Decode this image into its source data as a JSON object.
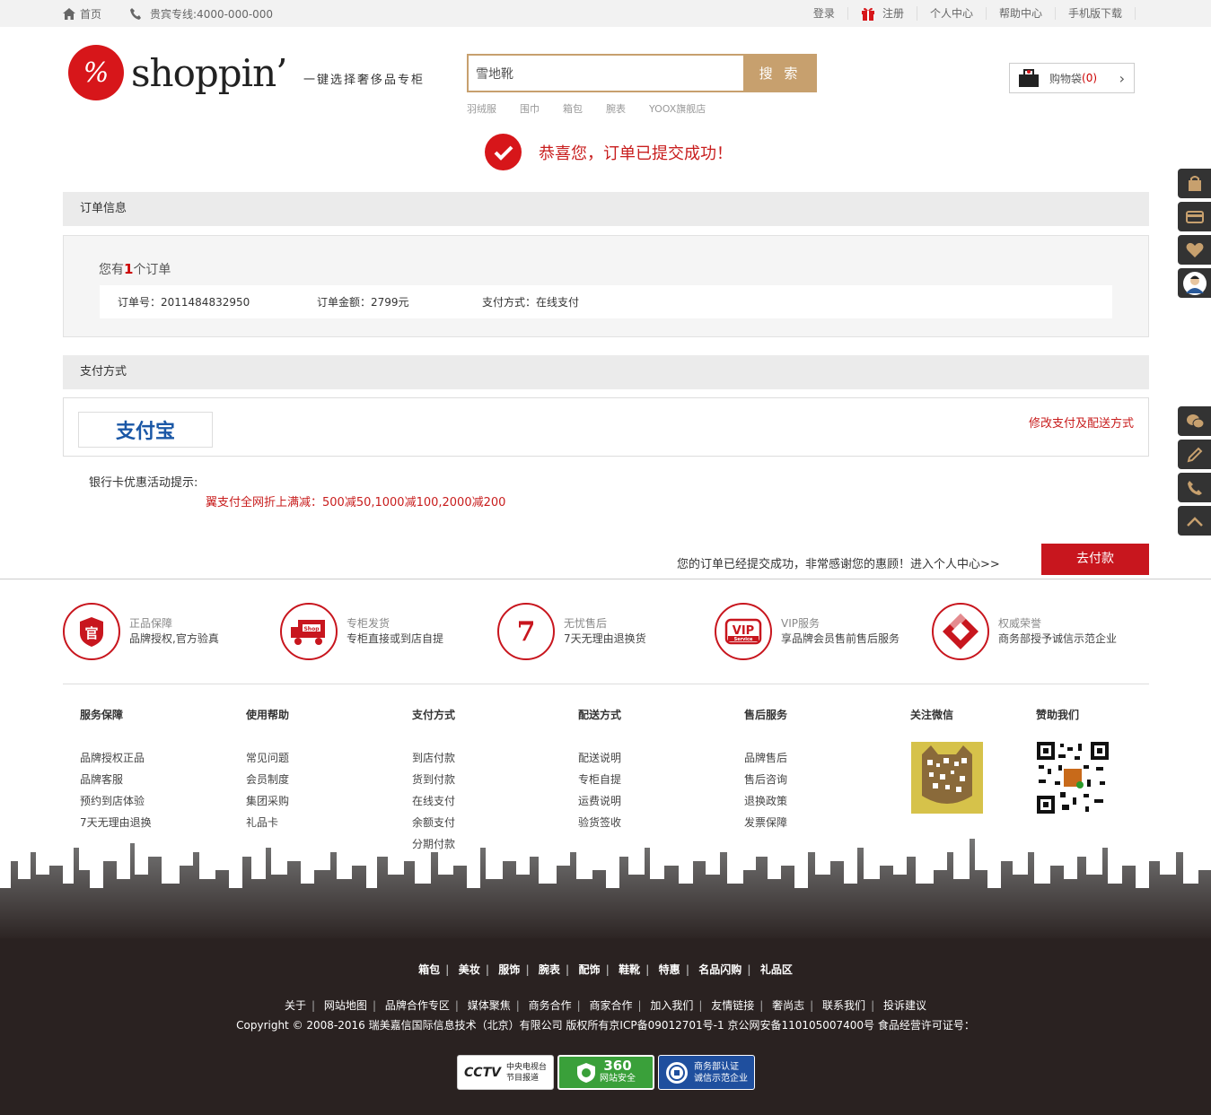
{
  "topbar": {
    "home": "首页",
    "hotline": "贵宾专线:4000-000-000",
    "login": "登录",
    "register": "注册",
    "user_center": "个人中心",
    "help": "帮助中心",
    "mobile": "手机版下载"
  },
  "brand": {
    "logo_mark": "%",
    "name": "shoppin’",
    "slogan": "一键选择奢侈品专柜"
  },
  "search": {
    "value": "雪地靴",
    "button": "搜 索",
    "hot": [
      "羽绒服",
      "围巾",
      "箱包",
      "腕表",
      "YOOX旗舰店"
    ]
  },
  "cart": {
    "label": "购物袋",
    "count_open": "(",
    "count": "0",
    "count_close": ")"
  },
  "success": {
    "message": "恭喜您，订单已提交成功！"
  },
  "order": {
    "section_title": "订单信息",
    "count_prefix": "您有",
    "count": "1",
    "count_suffix": "个订单",
    "number": "订单号：2011484832950",
    "amount": "订单金额：2799元",
    "pay_method": "支付方式：在线支付"
  },
  "payment": {
    "section_title": "支付方式",
    "provider": "支付宝",
    "modify": "修改支付及配送方式",
    "promo_title": "银行卡优惠活动提示:",
    "promo_detail": "翼支付全网折上满减：500减50,1000减100,2000减200"
  },
  "confirm": {
    "text": "您的订单已经提交成功，非常感谢您的惠顾！进入个人中心>>",
    "pay_button": "去付款"
  },
  "features": [
    {
      "icon": "guan",
      "title": "正品保障",
      "desc": "品牌授权,官方验真"
    },
    {
      "icon": "shop",
      "title": "专柜发货",
      "desc": "专柜直接或到店自提"
    },
    {
      "icon": "7",
      "title": "无忧售后",
      "desc": "7天无理由退换货"
    },
    {
      "icon": "VIP",
      "title": "VIP服务",
      "desc": "享品牌会员售前售后服务"
    },
    {
      "icon": "honor",
      "title": "权威荣誉",
      "desc": "商务部授予诚信示范企业"
    }
  ],
  "footer_cols": [
    {
      "title": "服务保障",
      "items": [
        "品牌授权正品",
        "品牌客服",
        "预约到店体验",
        "7天无理由退换"
      ]
    },
    {
      "title": "使用帮助",
      "items": [
        "常见问题",
        "会员制度",
        "集团采购",
        "礼品卡"
      ]
    },
    {
      "title": "支付方式",
      "items": [
        "到店付款",
        "货到付款",
        "在线支付",
        "余额支付",
        "分期付款"
      ]
    },
    {
      "title": "配送方式",
      "items": [
        "配送说明",
        "专柜自提",
        "运费说明",
        "验货签收"
      ]
    },
    {
      "title": "售后服务",
      "items": [
        "品牌售后",
        "售后咨询",
        "退换政策",
        "发票保障"
      ]
    },
    {
      "title": "关注微信",
      "items": []
    },
    {
      "title": "赞助我们",
      "items": []
    }
  ],
  "bottom_links_1": [
    "箱包",
    "美妆",
    "服饰",
    "腕表",
    "配饰",
    "鞋靴",
    "特惠",
    "名品闪购",
    "礼品区"
  ],
  "bottom_links_2": [
    "关于",
    "网站地图",
    "品牌合作专区",
    "媒体聚焦",
    "商务合作",
    "商家合作",
    "加入我们",
    "友情链接",
    "奢尚志",
    "联系我们",
    "投诉建议"
  ],
  "copyright": "Copyright © 2008-2016 瑞美嘉信国际信息技术（北京）有限公司  版权所有京ICP备09012701号-1 京公网安备110105007400号 食品经营许可证号：",
  "badges": [
    {
      "name": "CCTV",
      "line1": "中央电视台",
      "line2": "节目报道"
    },
    {
      "name": "360",
      "line1": "网站安全"
    },
    {
      "name": "商务部认证",
      "line1": "商务部认证",
      "line2": "诚信示范企业"
    }
  ],
  "colors": {
    "accent": "#c8161e",
    "gold": "#c7a06e",
    "footer_bg": "#2a2221"
  }
}
